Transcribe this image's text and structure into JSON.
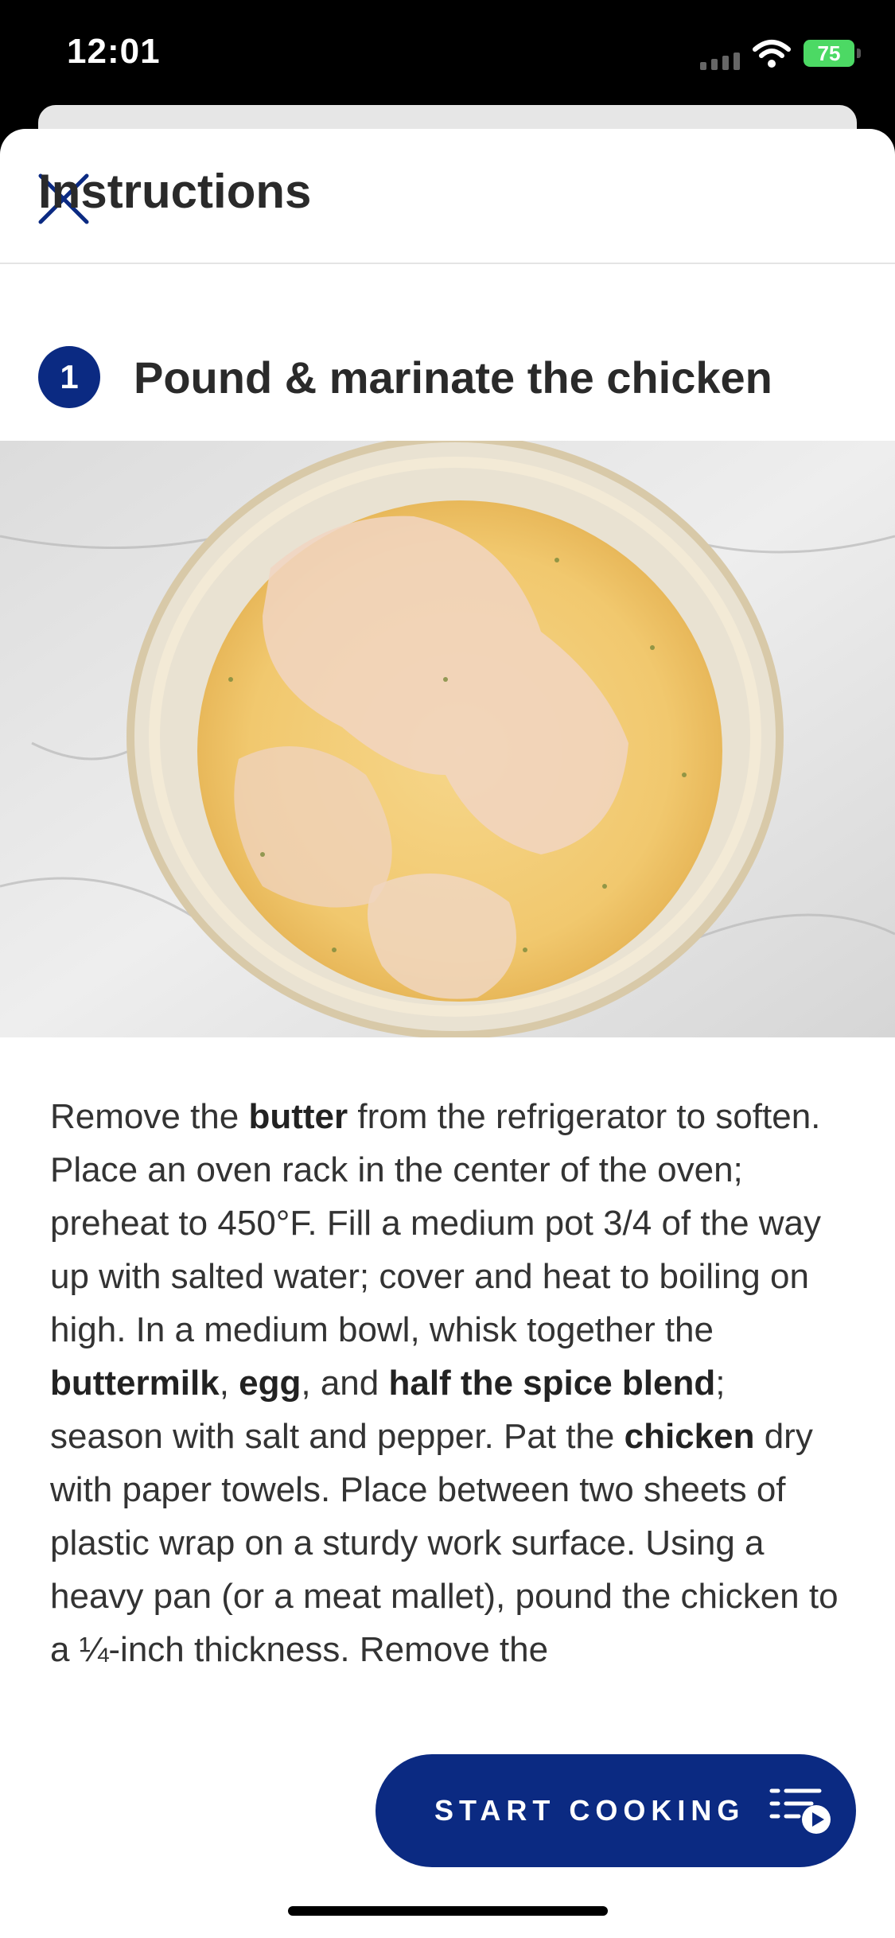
{
  "status_bar": {
    "time": "12:01",
    "battery": "75"
  },
  "header": {
    "close_icon": "close-icon"
  },
  "title": "Instructions",
  "step": {
    "number": "1",
    "title": "Pound & marinate the chicken",
    "photo": "marinated-chicken-bowl-photo",
    "text_parts": [
      {
        "t": "Remove the ",
        "b": false
      },
      {
        "t": "butter",
        "b": true
      },
      {
        "t": " from the refrigerator to soften. Place an oven rack in the center of the oven; preheat to 450°F. Fill a medium pot 3/4 of the way up with salted water; cover and heat to boiling on high. In a medium bowl, whisk together the ",
        "b": false
      },
      {
        "t": "buttermilk",
        "b": true
      },
      {
        "t": ", ",
        "b": false
      },
      {
        "t": "egg",
        "b": true
      },
      {
        "t": ", and ",
        "b": false
      },
      {
        "t": "half the spice blend",
        "b": true
      },
      {
        "t": "; season with salt and pepper. Pat the ",
        "b": false
      },
      {
        "t": "chicken",
        "b": true
      },
      {
        "t": " dry with paper towels. Place between two sheets of plastic wrap on a sturdy work surface. Using a heavy pan (or a meat mallet), pound the chicken to a ¼-inch thickness. Remove the",
        "b": false
      }
    ]
  },
  "start_button": {
    "label": "START COOKING",
    "icon": "cooking-list-play-icon"
  },
  "colors": {
    "brand": "#0b2a82"
  }
}
